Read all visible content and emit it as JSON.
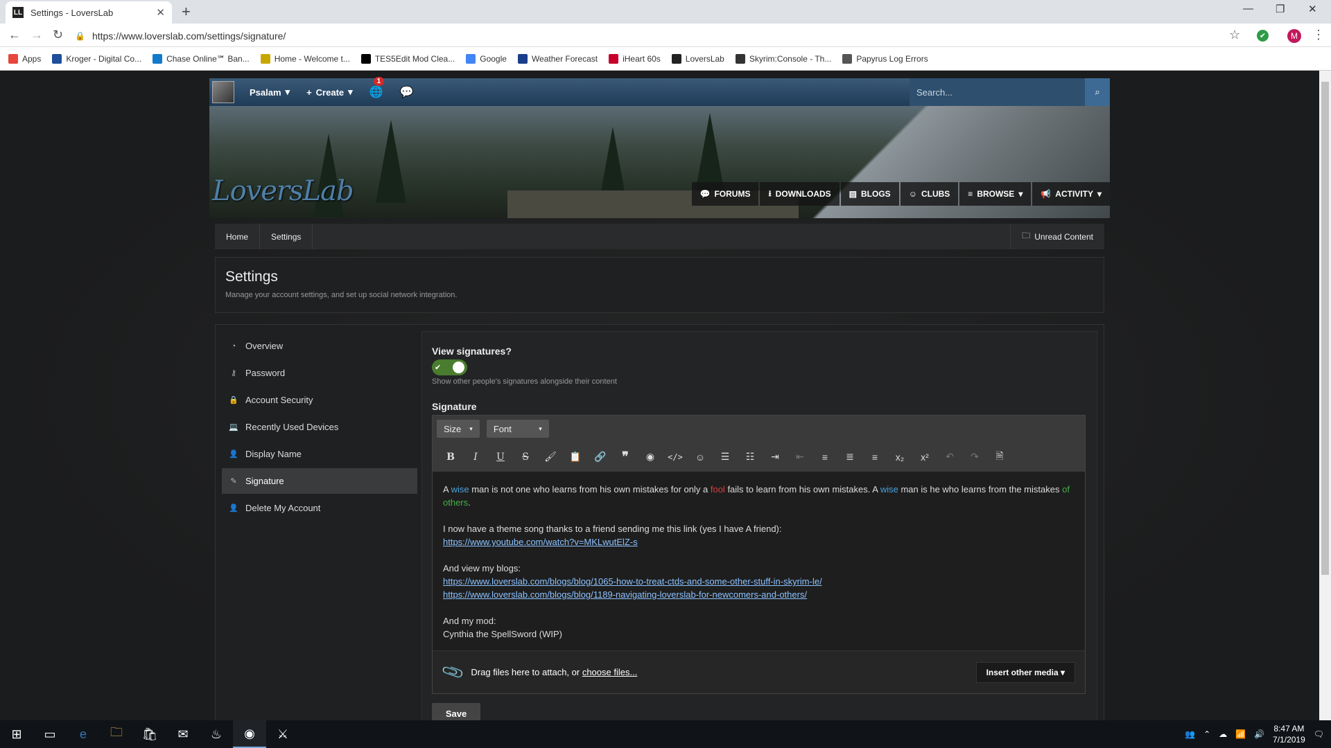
{
  "browser": {
    "tab_title": "Settings - LoversLab",
    "url": "https://www.loverslab.com/settings/signature/",
    "profile_initial": "M",
    "bookmarks": [
      {
        "label": "Apps",
        "color": "#e8453c"
      },
      {
        "label": "Kroger - Digital Co...",
        "color": "#1f4e9b"
      },
      {
        "label": "Chase Online℠ Ban...",
        "color": "#117aca"
      },
      {
        "label": "Home - Welcome t...",
        "color": "#c8a800"
      },
      {
        "label": "TES5Edit Mod Clea...",
        "color": "#000000"
      },
      {
        "label": "Google",
        "color": "#4285f4"
      },
      {
        "label": "Weather Forecast",
        "color": "#1a3e8c"
      },
      {
        "label": "iHeart 60s",
        "color": "#c6002b"
      },
      {
        "label": "LoversLab",
        "color": "#222222"
      },
      {
        "label": "Skyrim:Console - Th...",
        "color": "#333333"
      },
      {
        "label": "Papyrus Log Errors",
        "color": "#555555"
      }
    ]
  },
  "site": {
    "logo": "LoversLab",
    "user_name": "Psalam",
    "create_label": "Create",
    "notif_count": "1",
    "search_placeholder": "Search...",
    "main_nav": [
      "FORUMS",
      "DOWNLOADS",
      "BLOGS",
      "CLUBS",
      "BROWSE",
      "ACTIVITY"
    ],
    "breadcrumbs": [
      "Home",
      "Settings"
    ],
    "unread_label": "Unread Content"
  },
  "header": {
    "title": "Settings",
    "subtitle": "Manage your account settings, and set up social network integration."
  },
  "sidebar": {
    "items": [
      {
        "label": "Overview",
        "icon": "dashboard-icon"
      },
      {
        "label": "Password",
        "icon": "key-icon"
      },
      {
        "label": "Account Security",
        "icon": "lock-icon"
      },
      {
        "label": "Recently Used Devices",
        "icon": "laptop-icon"
      },
      {
        "label": "Display Name",
        "icon": "user-icon"
      },
      {
        "label": "Signature",
        "icon": "pencil-icon",
        "active": true
      },
      {
        "label": "Delete My Account",
        "icon": "user-delete-icon"
      }
    ]
  },
  "form": {
    "view_sig_label": "View signatures?",
    "view_sig_enabled": true,
    "view_sig_desc": "Show other people's signatures alongside their content",
    "signature_label": "Signature",
    "size_label": "Size",
    "font_label": "Font",
    "body": {
      "l1_a": "A ",
      "l1_wise1": "wise",
      "l1_b": " man is not one who learns from his own mistakes for only a ",
      "l1_fool": "fool",
      "l1_c": " fails to learn from his own mistakes. A ",
      "l1_wise2": "wise",
      "l1_d": " man is he who learns from the mistakes ",
      "l1_others": "of others",
      "l1_e": ".",
      "l2": "I now have a theme song thanks to a friend sending me this link (yes I have A friend):",
      "l3": "https://www.youtube.com/watch?v=MKLwutElZ-s",
      "l4": "And view my blogs:",
      "l5": "https://www.loverslab.com/blogs/blog/1065-how-to-treat-ctds-and-some-other-stuff-in-skyrim-le/",
      "l6": "https://www.loverslab.com/blogs/blog/1189-navigating-loverslab-for-newcomers-and-others/",
      "l7": "And my mod:",
      "l8": "Cynthia the SpellSword (WIP)"
    },
    "attach_text": "Drag files here to attach, or ",
    "attach_link": "choose files...",
    "insert_media": "Insert other media",
    "save_label": "Save"
  },
  "taskbar": {
    "time": "8:47 AM",
    "date": "7/1/2019"
  }
}
